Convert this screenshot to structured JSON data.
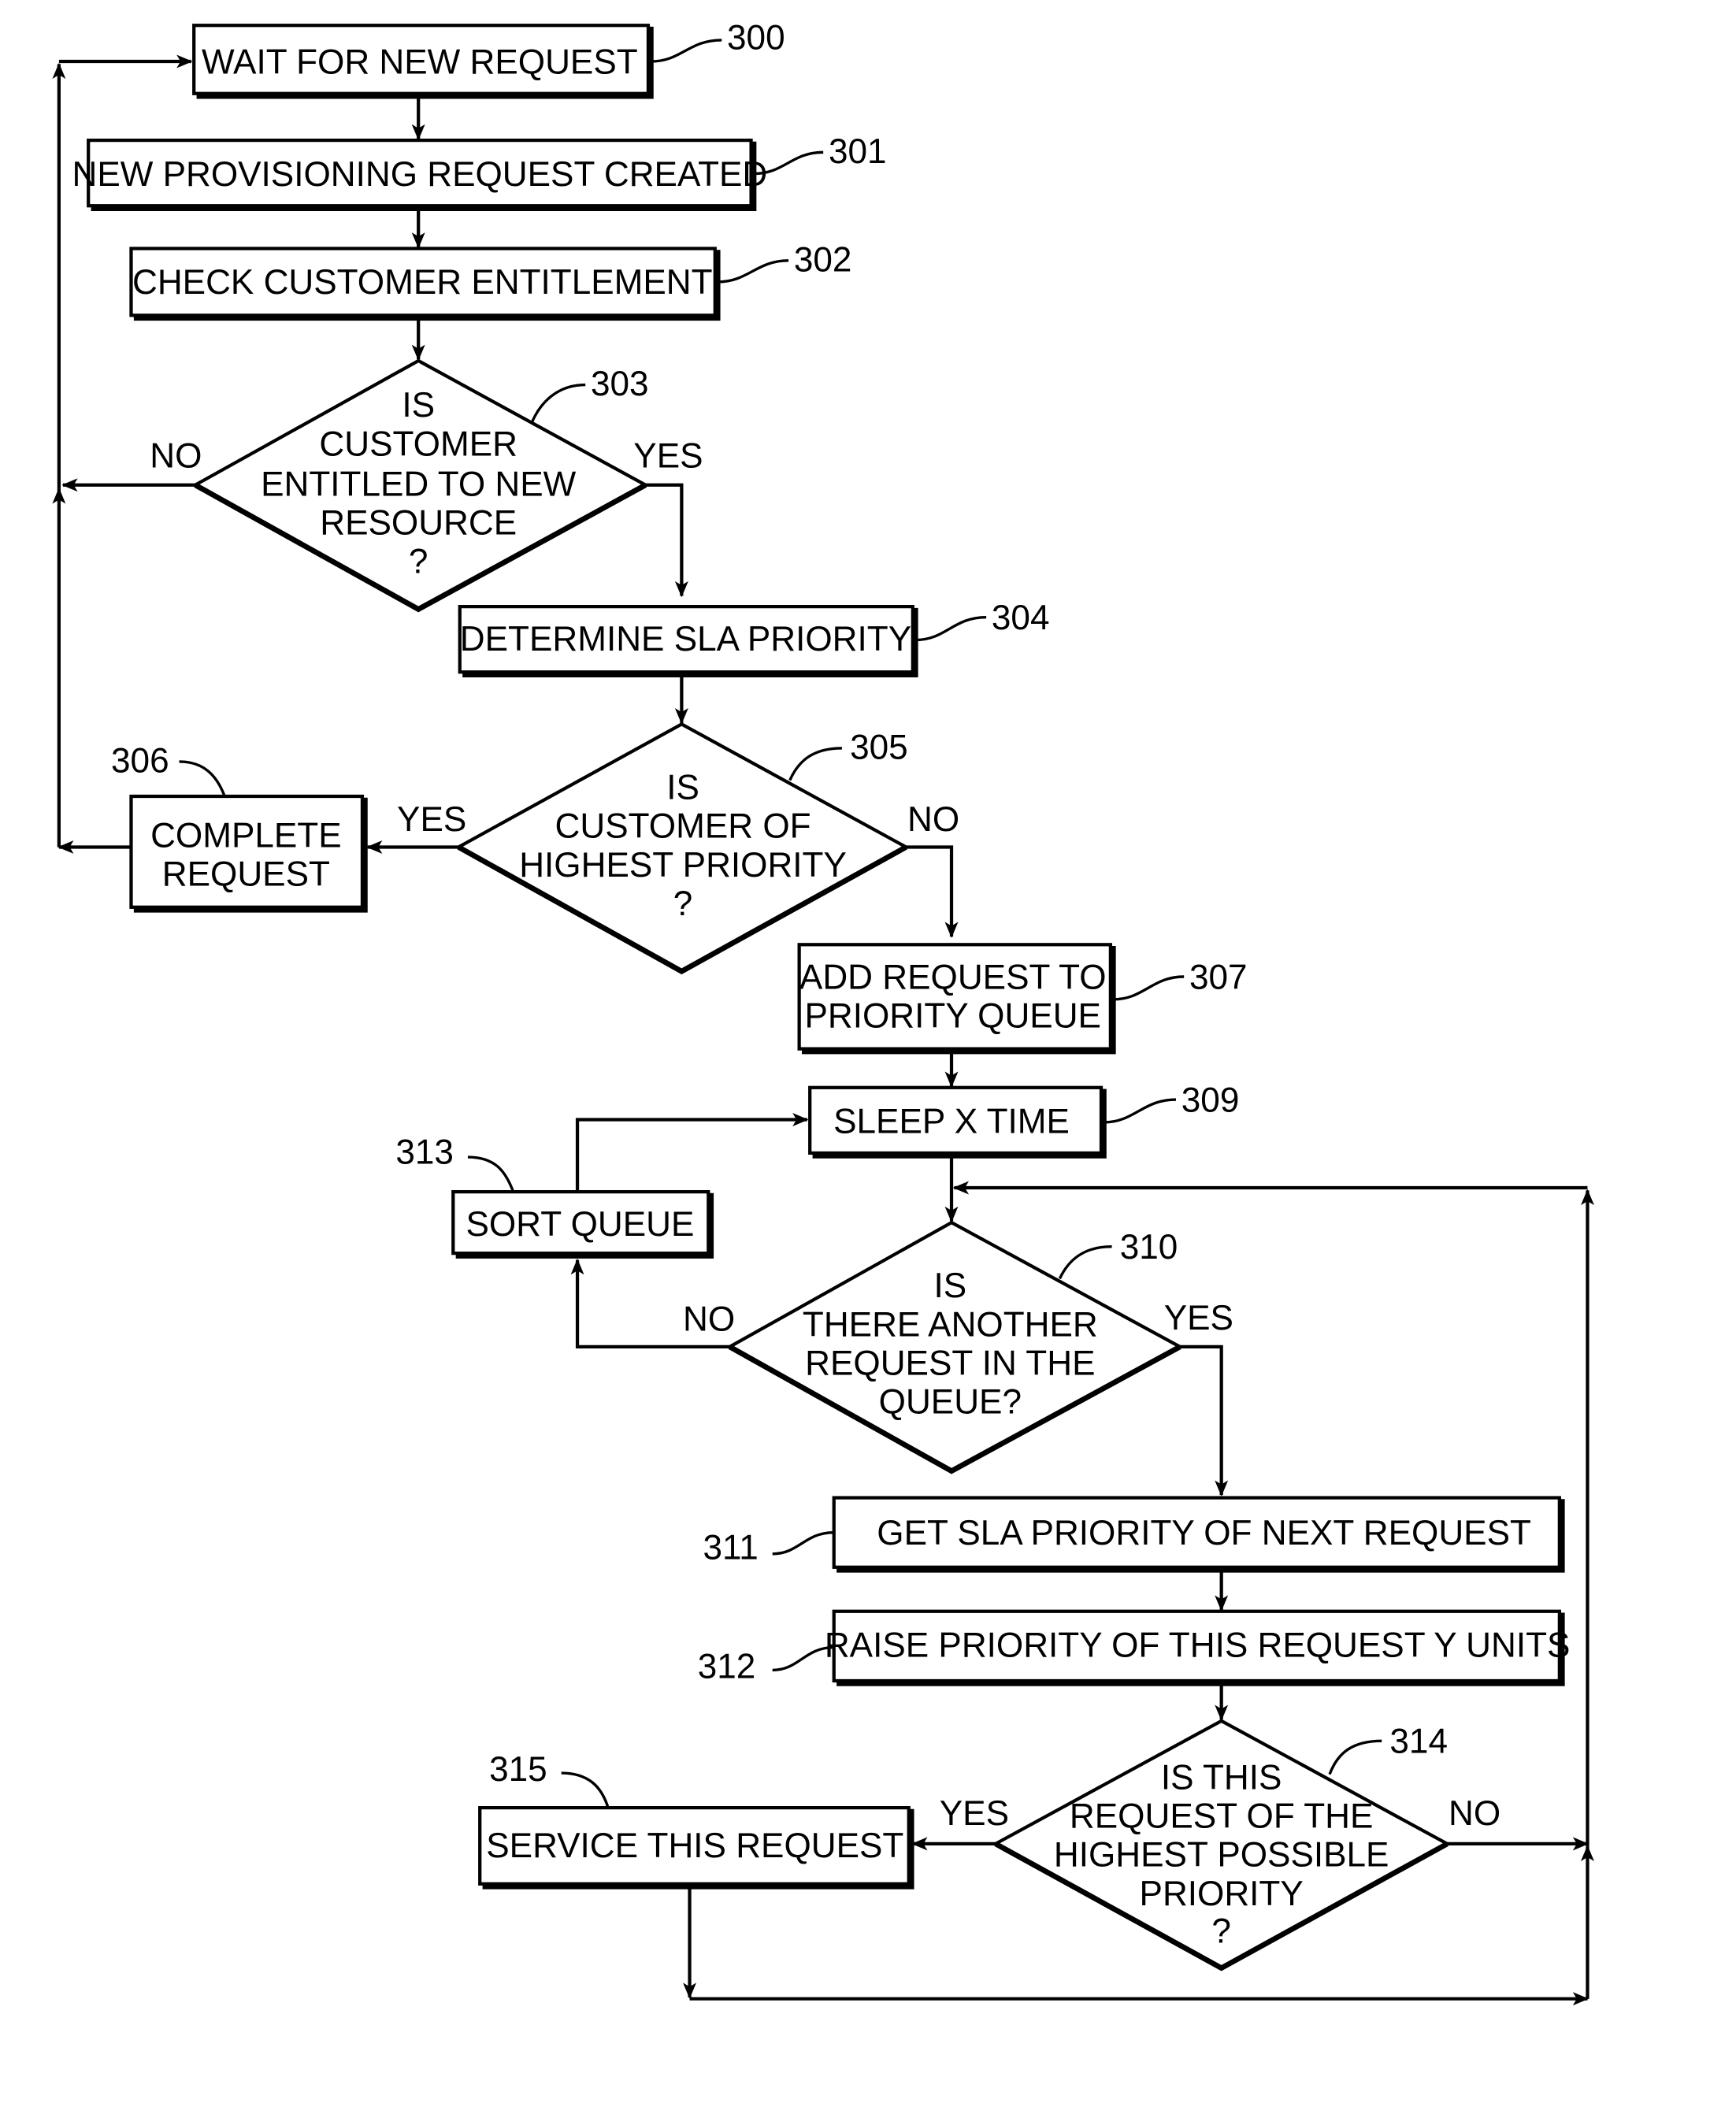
{
  "figure": {
    "steps": [
      {
        "ref": "300",
        "lines": [
          "WAIT FOR NEW REQUEST"
        ]
      },
      {
        "ref": "301",
        "lines": [
          "NEW PROVISIONING REQUEST CREATED"
        ]
      },
      {
        "ref": "302",
        "lines": [
          "CHECK CUSTOMER ENTITLEMENT"
        ]
      },
      {
        "ref": "303",
        "lines": [
          "IS",
          "CUSTOMER",
          "ENTITLED TO NEW",
          "RESOURCE",
          "?"
        ]
      },
      {
        "ref": "304",
        "lines": [
          "DETERMINE SLA PRIORITY"
        ]
      },
      {
        "ref": "305",
        "lines": [
          "IS",
          "CUSTOMER OF",
          "HIGHEST PRIORITY",
          "?"
        ]
      },
      {
        "ref": "306",
        "lines": [
          "COMPLETE",
          "REQUEST"
        ]
      },
      {
        "ref": "307",
        "lines": [
          "ADD REQUEST TO",
          "PRIORITY QUEUE"
        ]
      },
      {
        "ref": "309",
        "lines": [
          "SLEEP X TIME"
        ]
      },
      {
        "ref": "310",
        "lines": [
          "IS",
          "THERE ANOTHER",
          "REQUEST IN THE",
          "QUEUE?"
        ]
      },
      {
        "ref": "311",
        "lines": [
          "GET SLA PRIORITY OF NEXT REQUEST"
        ]
      },
      {
        "ref": "312",
        "lines": [
          "RAISE PRIORITY OF THIS REQUEST Y UNITS"
        ]
      },
      {
        "ref": "313",
        "lines": [
          "SORT QUEUE"
        ]
      },
      {
        "ref": "314",
        "lines": [
          "IS THIS",
          "REQUEST OF THE",
          "HIGHEST POSSIBLE",
          "PRIORITY",
          "?"
        ]
      },
      {
        "ref": "315",
        "lines": [
          "SERVICE THIS REQUEST"
        ]
      }
    ],
    "branch_labels": {
      "d303_no": "NO",
      "d303_yes": "YES",
      "d305_yes": "YES",
      "d305_no": "NO",
      "d310_no": "NO",
      "d310_yes": "YES",
      "d314_yes": "YES",
      "d314_no": "NO"
    }
  }
}
